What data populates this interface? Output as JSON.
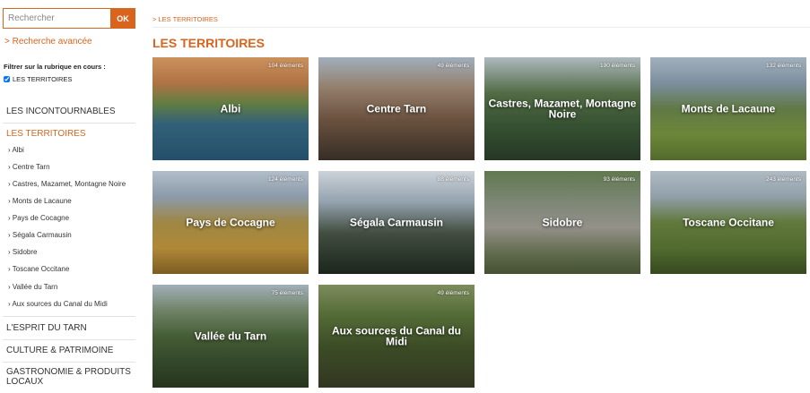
{
  "search": {
    "placeholder": "Rechercher",
    "button_label": "OK"
  },
  "advanced_search_label": "> Recherche avancée",
  "filter": {
    "label": "Filtrer sur la rubrique en cours :",
    "checkbox_label": "LES TERRITOIRES",
    "checked": true
  },
  "menu": {
    "incontournables": "LES INCONTOURNABLES",
    "territoires": "LES TERRITOIRES",
    "sub_items": [
      "› Albi",
      "› Centre Tarn",
      "› Castres, Mazamet, Montagne Noire",
      "› Monts de Lacaune",
      "› Pays de Cocagne",
      "› Ségala Carmausin",
      "› Sidobre",
      "› Toscane Occitane",
      "› Vallée du Tarn",
      "› Aux sources du Canal du Midi"
    ],
    "esprit": "L'ESPRIT DU TARN",
    "culture": "CULTURE & PATRIMOINE",
    "gastronomie": "GASTRONOMIE & PRODUITS LOCAUX"
  },
  "breadcrumb": "> LES TERRITOIRES",
  "page_title": "LES TERRITOIRES",
  "tiles": [
    {
      "name": "Albi",
      "count": "104 éléments"
    },
    {
      "name": "Centre Tarn",
      "count": "49 éléments"
    },
    {
      "name": "Castres, Mazamet, Montagne Noire",
      "count": "190 éléments"
    },
    {
      "name": "Monts de Lacaune",
      "count": "132 éléments"
    },
    {
      "name": "Pays de Cocagne",
      "count": "124 éléments"
    },
    {
      "name": "Ségala Carmausin",
      "count": "88 éléments"
    },
    {
      "name": "Sidobre",
      "count": "93 éléments"
    },
    {
      "name": "Toscane Occitane",
      "count": "243 éléments"
    },
    {
      "name": "Vallée du Tarn",
      "count": "75 éléments"
    },
    {
      "name": "Aux sources du Canal du Midi",
      "count": "49 éléments"
    }
  ],
  "colors": {
    "accent": "#d9641e"
  }
}
